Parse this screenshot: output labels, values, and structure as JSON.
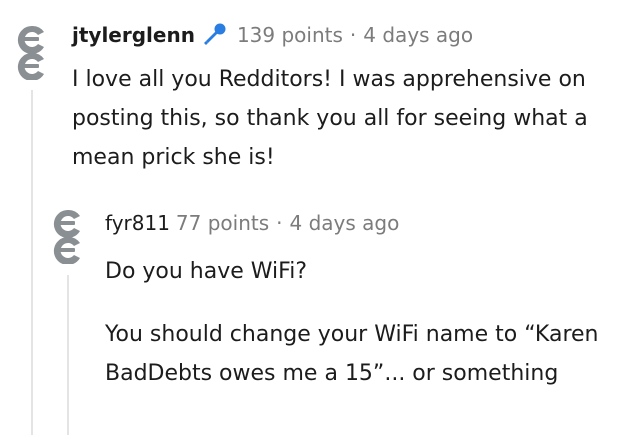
{
  "comments": [
    {
      "username": "jtylerglenn",
      "points": "139 points",
      "separator": "·",
      "time": "4 days ago",
      "body": "I love all you Redditors! I was apprehensive on posting this, so thank you all for seeing what a mean prick she is!",
      "badge_icon": "microphone-icon"
    },
    {
      "username": "fyr811",
      "points": "77 points",
      "separator": "·",
      "time": "4 days ago",
      "body_paragraphs": [
        "Do you have WiFi?",
        "You should change your WiFi name to “Karen BadDebts owes me a 15”... or something"
      ]
    }
  ],
  "colors": {
    "text": "#1c1c1c",
    "meta": "#7c7c7c",
    "avatar": "#8a8f93",
    "badge": "#2a7de1",
    "thread_line": "#e4e4e4"
  }
}
